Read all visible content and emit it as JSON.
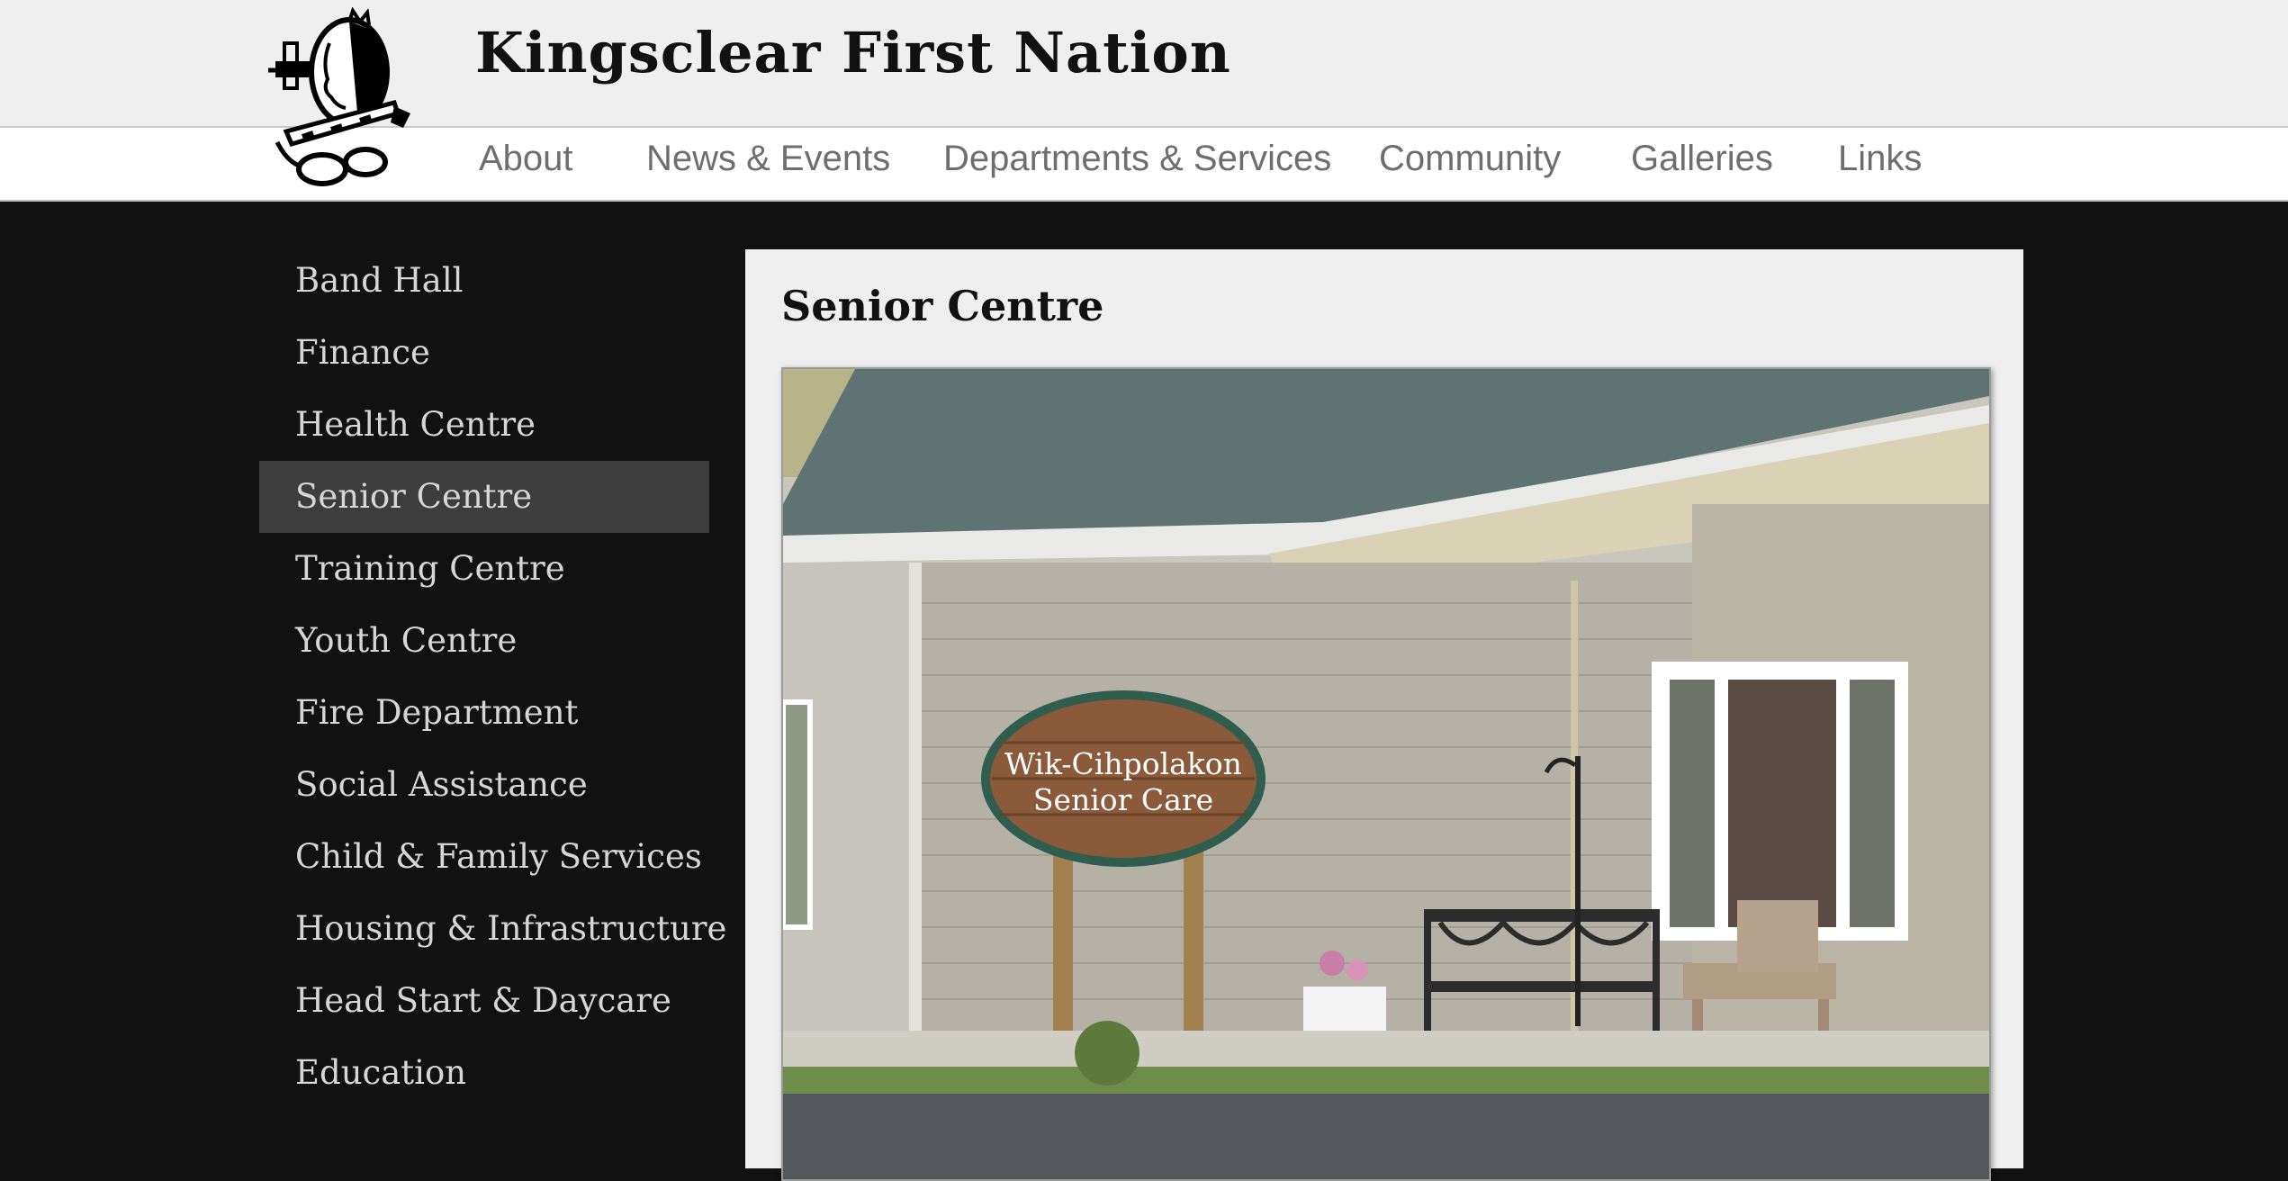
{
  "site": {
    "title": "Kingsclear First Nation"
  },
  "nav": {
    "items": [
      {
        "label": "About"
      },
      {
        "label": "News & Events"
      },
      {
        "label": "Departments & Services"
      },
      {
        "label": "Community"
      },
      {
        "label": "Galleries"
      },
      {
        "label": "Links"
      }
    ]
  },
  "sidebar": {
    "items": [
      {
        "label": "Band Hall"
      },
      {
        "label": "Finance"
      },
      {
        "label": "Health Centre"
      },
      {
        "label": "Senior Centre",
        "active": true
      },
      {
        "label": "Training Centre"
      },
      {
        "label": "Youth Centre"
      },
      {
        "label": "Fire Department"
      },
      {
        "label": "Social Assistance"
      },
      {
        "label": "Child & Family Services"
      },
      {
        "label": "Housing & Infrastructure"
      },
      {
        "label": "Head Start & Daycare"
      },
      {
        "label": "Education"
      }
    ]
  },
  "main": {
    "title": "Senior Centre",
    "photo": {
      "sign_line1": "Wik-Cihpolakon",
      "sign_line2": "Senior Care"
    }
  },
  "colors": {
    "page_bg": "#111111",
    "header_bg": "#efefef",
    "nav_text": "#6e6e6e",
    "sidebar_text": "#d6d6d6",
    "sidebar_active_bg": "#3d3d3d",
    "content_bg": "#efefef"
  }
}
